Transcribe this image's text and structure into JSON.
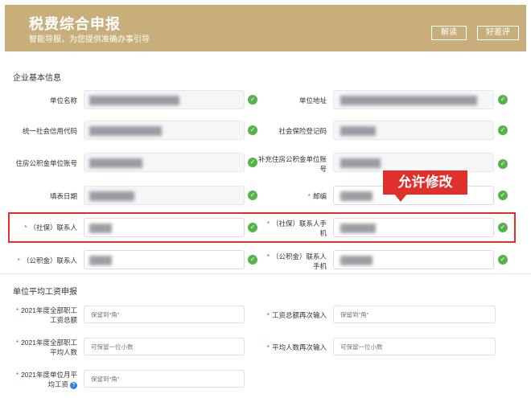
{
  "header": {
    "title": "税费综合申报",
    "subtitle": "智能导服，为您提供准确办事引导",
    "btn_explain": "解读",
    "btn_rate": "好差评"
  },
  "section1": {
    "title": "企业基本信息",
    "labels": {
      "unit_name": "单位名称",
      "unit_address": "单位地址",
      "credit_code": "统一社会信用代码",
      "social_reg": "社会保险登记码",
      "fund_account": "住房公积金单位账号",
      "fund_extra_1": "补充住房公积金单位账",
      "fund_extra_2": "号",
      "fill_date": "填表日期",
      "postcode": "邮编",
      "si_contact": "（社保）联系人",
      "si_phone_1": "（社保）联系人手",
      "si_phone_2": "机",
      "pf_contact": "（公积金）联系人",
      "pf_phone_1": "（公积金）联系人",
      "pf_phone_2": "手机"
    },
    "required_mark": "*"
  },
  "annotation": "允许修改",
  "section2": {
    "title": "单位平均工资申报",
    "labels": {
      "total_wage_1": "2021年度全部职工",
      "total_wage_2": "工资总额",
      "total_wage_again": "工资总额再次输入",
      "avg_count_1": "2021年度全部职工",
      "avg_count_2": "平均人数",
      "avg_count_again": "平均人数再次输入",
      "monthly_avg_1": "2021年度单位月平",
      "monthly_avg_2": "均工资"
    },
    "placeholders": {
      "to_jiao": "保留到\"角\"",
      "one_decimal": "可保留一位小数"
    },
    "help_icon": "?"
  },
  "icons": {
    "check": "✓"
  }
}
